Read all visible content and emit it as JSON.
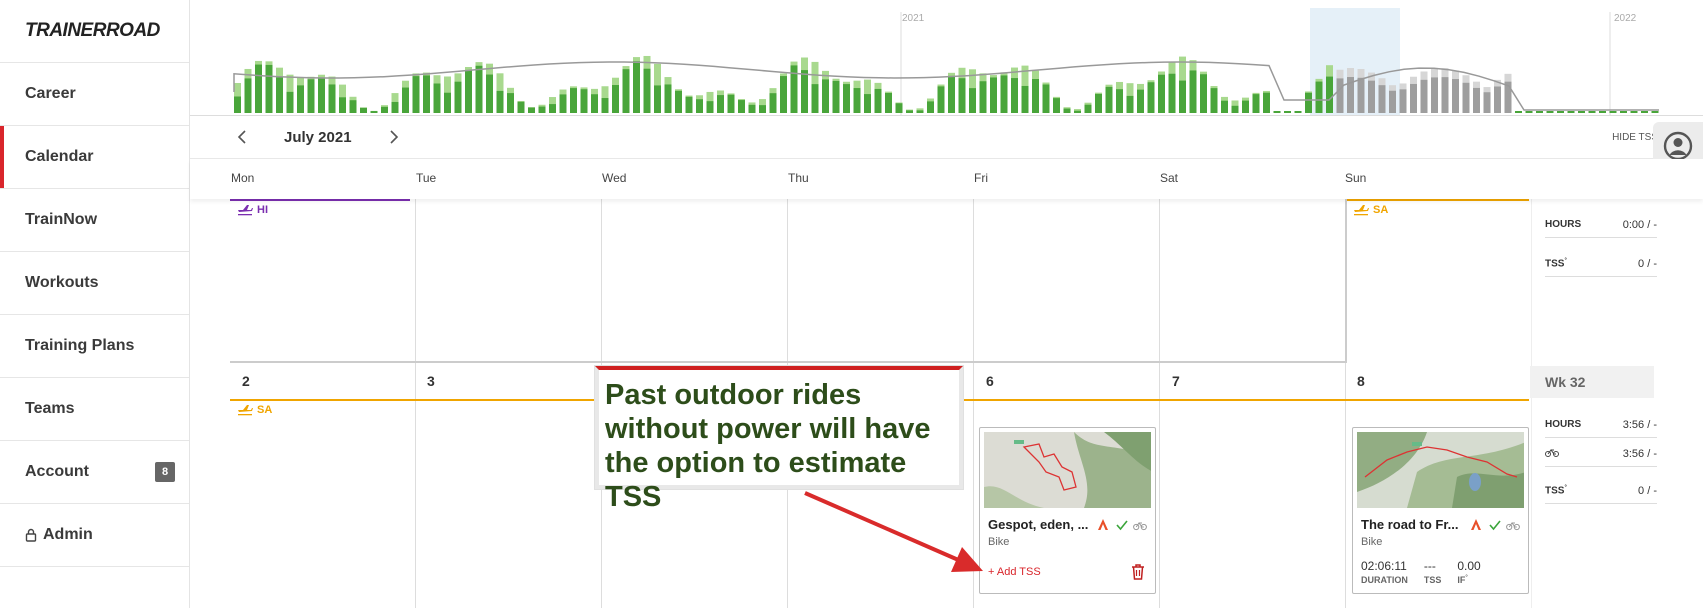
{
  "brand": {
    "logo": "TRAINERROAD"
  },
  "sidebar": {
    "items": [
      {
        "label": "Career"
      },
      {
        "label": "Calendar",
        "active": true
      },
      {
        "label": "TrainNow"
      },
      {
        "label": "Workouts"
      },
      {
        "label": "Training Plans"
      },
      {
        "label": "Teams"
      },
      {
        "label": "Account",
        "badge": "8"
      },
      {
        "label": "Admin",
        "icon": "lock-icon"
      }
    ]
  },
  "history": {
    "year_2021": "2021",
    "year_2022": "2022"
  },
  "header": {
    "month": "July 2021",
    "prev_icon": "chevron-left-icon",
    "next_icon": "chevron-right-icon",
    "hide_tss": "HIDE TSS",
    "profile_icon": "user-avatar-icon"
  },
  "days": [
    "Mon",
    "Tue",
    "Wed",
    "Thu",
    "Fri",
    "Sat",
    "Sun"
  ],
  "week1": {
    "mon_travel": "HI",
    "sun_travel": "SA",
    "stats": {
      "hours_label": "HOURS",
      "hours_value": "0:00 / -",
      "tss_label": "TSS",
      "tss_value": "0 / -"
    }
  },
  "week2": {
    "wk_label": "Wk 32",
    "day_numbers": [
      "2",
      "3",
      "6",
      "7",
      "8"
    ],
    "mon_travel": "SA",
    "stats": {
      "hours_label": "HOURS",
      "hours_value": "3:56 / -",
      "bike_value": "3:56 / -",
      "tss_label": "TSS",
      "tss_value": "0 / -"
    }
  },
  "cards": [
    {
      "title": "Gespot, eden, ...",
      "type": "Bike",
      "add_tss": "+ Add TSS"
    },
    {
      "title": "The road to Fr...",
      "type": "Bike",
      "duration": "02:06:11",
      "duration_label": "DURATION",
      "tss": "---",
      "tss_label": "TSS",
      "if": "0.00",
      "if_label": "IF"
    }
  ],
  "annotation": {
    "text": "Past outdoor rides without power will have the option to estimate TSS"
  },
  "colors": {
    "accent": "#d9252b",
    "travel_orange": "#f0a500",
    "travel_purple": "#7b2fb0",
    "bar_dark": "#49a53a",
    "bar_light": "#a8d98e",
    "bar_future": "#bdbdbd",
    "callout_text": "#2d4d1a"
  }
}
